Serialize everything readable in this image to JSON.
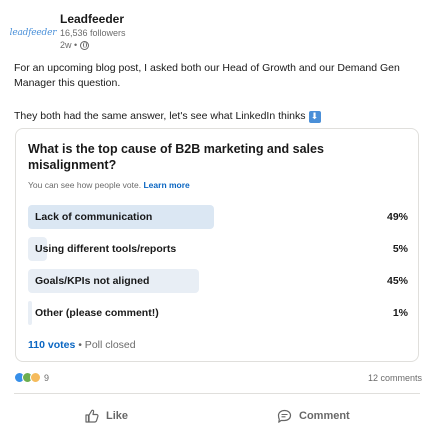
{
  "header": {
    "logo_text": "leadfeeder",
    "company": "Leadfeeder",
    "followers": "16,536 followers",
    "age": "2w •"
  },
  "body": {
    "paragraph1": "For an upcoming blog post, I asked both our Head of Growth and our Demand Gen Manager this question.",
    "paragraph2": "They both had the same answer, let's see what LinkedIn thinks",
    "emoji": "⬇"
  },
  "poll": {
    "question": "What is the top cause of B2B marketing and sales misalignment?",
    "visibility_text": "You can see how people vote.",
    "learn_more": "Learn more",
    "options": [
      {
        "label": "Lack of communication",
        "percent_text": "49%",
        "percent": 49
      },
      {
        "label": "Using different tools/reports",
        "percent_text": "5%",
        "percent": 5
      },
      {
        "label": "Goals/KPIs not aligned",
        "percent_text": "45%",
        "percent": 45
      },
      {
        "label": "Other (please comment!)",
        "percent_text": "1%",
        "percent": 1
      }
    ],
    "votes": "110 votes",
    "status": "• Poll closed"
  },
  "social": {
    "reaction_count": "9",
    "comments": "12 comments"
  },
  "actions": {
    "like": "Like",
    "comment": "Comment"
  },
  "colors": {
    "accent": "#0a66c2",
    "bar_top": "#dbe7f3",
    "bar": "#e8eef5"
  }
}
